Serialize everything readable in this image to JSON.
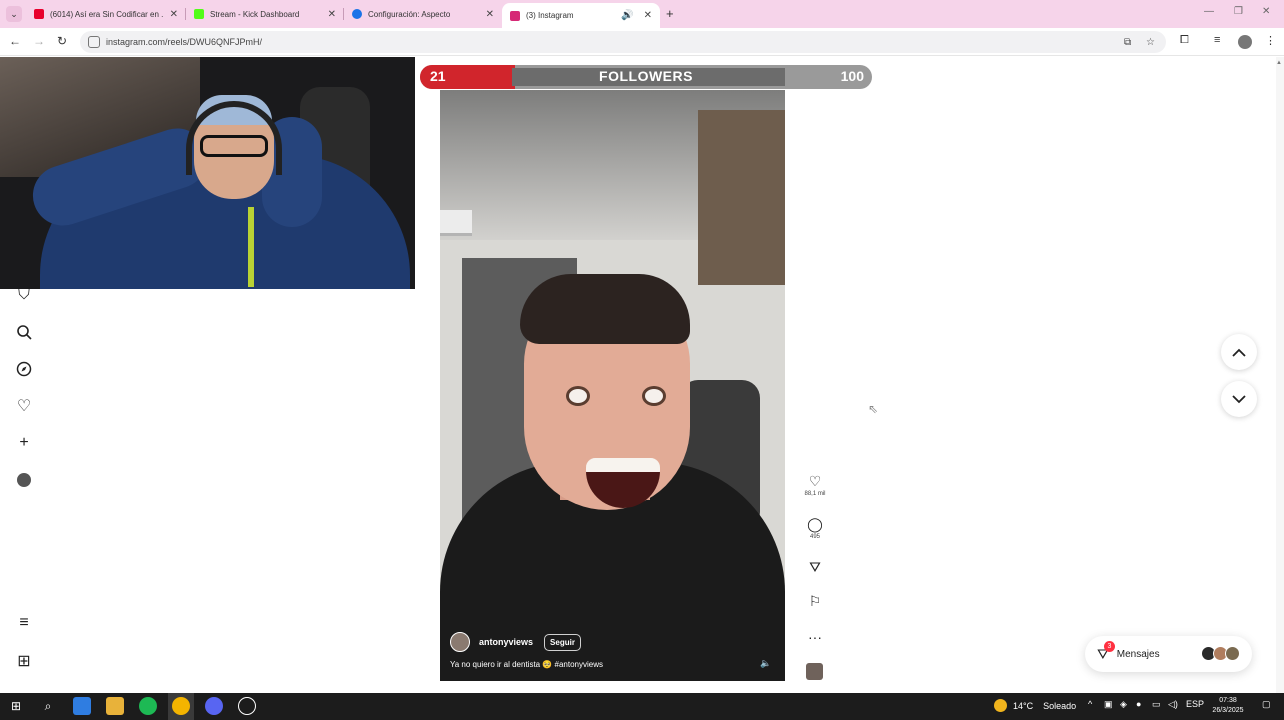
{
  "browser": {
    "tabs": [
      {
        "title": "(6014) Así era Sin Codificar en ...",
        "color": "#e8002d",
        "icon": "youtube-icon"
      },
      {
        "title": "Stream - Kick Dashboard",
        "color": "#53fc18",
        "icon": "kick-icon"
      },
      {
        "title": "Configuración: Aspecto",
        "color": "#1a73e8",
        "icon": "settings-icon"
      },
      {
        "title": "(3) Instagram",
        "color": "#d62976",
        "icon": "instagram-icon"
      }
    ],
    "url": "instagram.com/reels/DWU6QNFJPmH/"
  },
  "overlay": {
    "goal": {
      "current": "21",
      "label": "FOLLOWERS",
      "target": "100",
      "progress_fraction": 0.21,
      "color": "#d1252c"
    }
  },
  "reel": {
    "username": "antonyviews",
    "follow_label": "Seguir",
    "caption": "Ya no quiero ir al dentista 🥺 #antonyviews"
  },
  "actions": {
    "likes": "88,1 mil",
    "comments": "495"
  },
  "messages": {
    "label": "Mensajes",
    "badge": "3"
  },
  "taskbar": {
    "temperature": "14°C",
    "weather": "Soleado",
    "language": "ESP",
    "time": "07:38",
    "date": "26/3/2025"
  }
}
